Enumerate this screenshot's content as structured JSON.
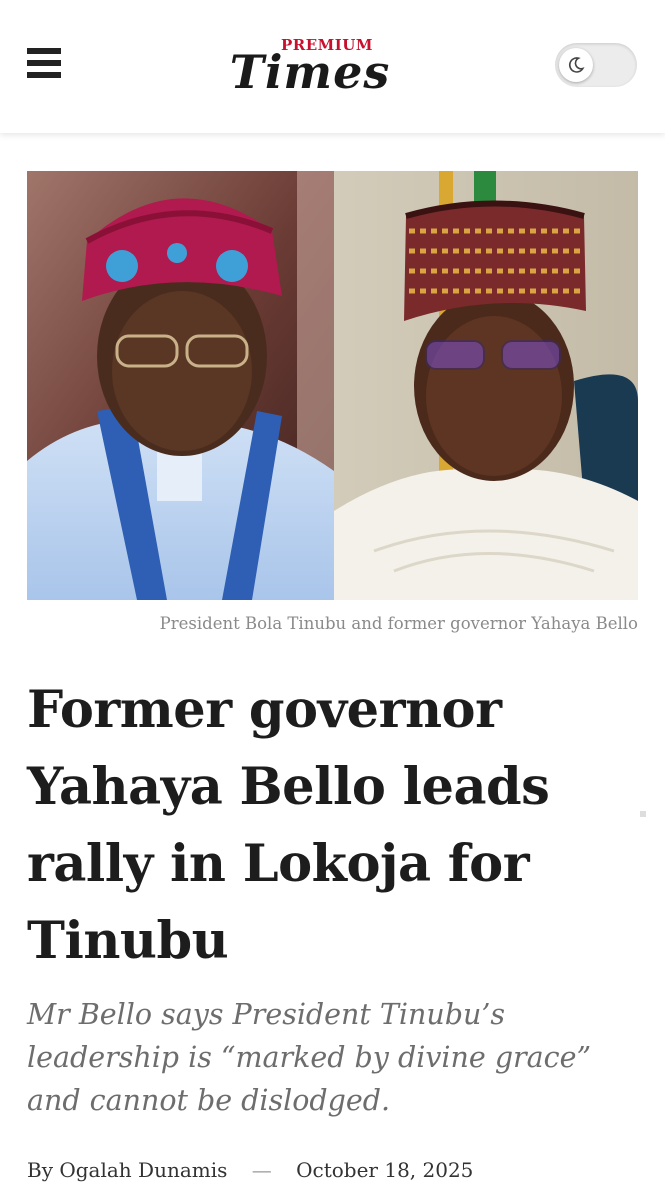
{
  "header": {
    "logo_premium": "PREMIUM",
    "logo_times": "Times",
    "menu_icon": "hamburger-menu-icon",
    "theme_toggle_icon": "moon-icon",
    "brand_color": "#c8102e"
  },
  "article": {
    "image_caption": "President Bola Tinubu and former governor Yahaya Bello",
    "headline": "Former governor Yahaya Bello leads rally in Lokoja for Tinubu",
    "subheadline": "Mr Bello says President Tinubu’s leadership is “marked by divine grace” and cannot be dislodged.",
    "byline_prefix": "By",
    "author": "Ogalah Dunamis",
    "separator": "—",
    "date": "October 18, 2025"
  }
}
